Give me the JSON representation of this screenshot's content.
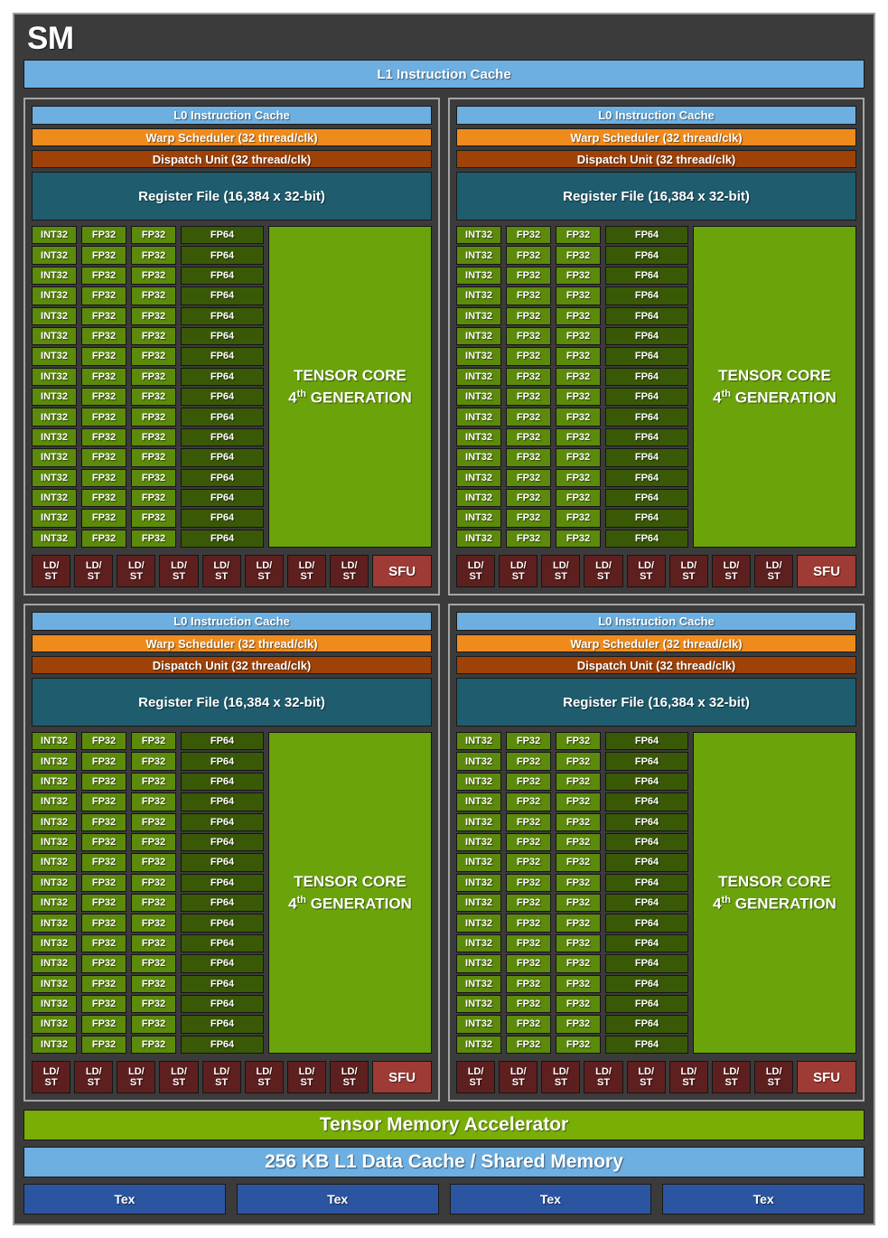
{
  "diagram": {
    "title": "SM",
    "top_cache": {
      "label": "L1 Instruction Cache"
    },
    "processing_block": {
      "l0_cache": "L0 Instruction Cache",
      "warp_scheduler": "Warp Scheduler (32 thread/clk)",
      "dispatch_unit": "Dispatch Unit (32 thread/clk)",
      "register_file": "Register File (16,384 x 32-bit)",
      "core_labels": {
        "int32": "INT32",
        "fp32": "FP32",
        "fp64": "FP64"
      },
      "core_rows": 16,
      "int32_columns": 1,
      "fp32_columns": 2,
      "fp64_columns": 1,
      "tensor_core": {
        "line1": "TENSOR CORE",
        "generation_number": "4",
        "generation_ordinal": "th",
        "line2_suffix": "GENERATION"
      },
      "ldst_label_top": "LD/",
      "ldst_label_bottom": "ST",
      "ldst_count": 8,
      "sfu_label": "SFU"
    },
    "blocks": [
      {
        "name": "processing-block-top-left"
      },
      {
        "name": "processing-block-top-right"
      },
      {
        "name": "processing-block-bottom-left"
      },
      {
        "name": "processing-block-bottom-right"
      }
    ],
    "tensor_memory_accelerator": "Tensor Memory Accelerator",
    "l1_data_cache": "256 KB L1 Data Cache / Shared Memory",
    "tex_units": [
      "Tex",
      "Tex",
      "Tex",
      "Tex"
    ],
    "colors": {
      "background": "#3b3b3b",
      "frame_border": "#9b9b9b",
      "cache_blue": "#6cafe0",
      "warp_orange": "#ef8b1c",
      "dispatch_brown": "#9e4208",
      "register_teal": "#1e5c6e",
      "core_green": "#5c8a0a",
      "fp64_green": "#3a5907",
      "tensor_green": "#6ba30b",
      "tma_green": "#79ae07",
      "ldst_red": "#5e1f1f",
      "sfu_red": "#9e3b34",
      "tex_blue": "#2b55a0",
      "text_white": "#ffffff"
    }
  }
}
